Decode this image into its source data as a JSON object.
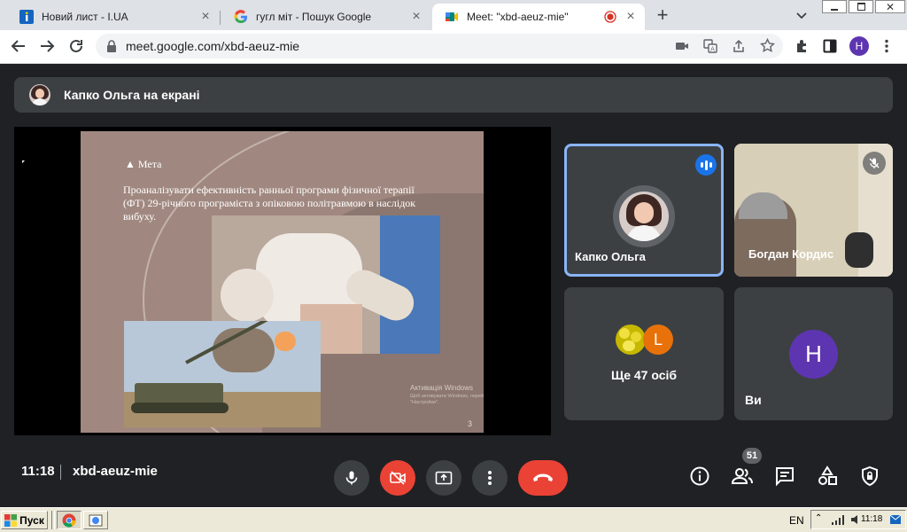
{
  "browser": {
    "tabs": [
      {
        "title": "Новий лист - I.UA",
        "close": "×"
      },
      {
        "title": "гугл міт - Пошук Google",
        "close": "×"
      },
      {
        "title": "Meet: \"xbd-aeuz-mie\"",
        "close": "×"
      }
    ],
    "new_tab": "+",
    "url": "meet.google.com/xbd-aeuz-mie",
    "profile_initial": "H"
  },
  "meet": {
    "presenter_banner": "Капко Ольга на екрані",
    "slide": {
      "heading": "▲ Мета",
      "body": "Проаналізувати ефективність ранньої програми фізичної терапії (ФТ) 29-річного програміста з опіковою політравмою в наслідок вибуху.",
      "watermark_title": "Активація Windows",
      "watermark_text": "Щоб активувати Windows, перейдіть до розділу \"Настройки\".",
      "page_number": "3"
    },
    "tiles": [
      {
        "name": "Капко Ольга",
        "speaking": true
      },
      {
        "name": "Богдан Кордис",
        "muted": true
      },
      {
        "name": "Ще 47 осіб",
        "avatar_letter": "L"
      },
      {
        "name": "Ви",
        "avatar_letter": "H"
      }
    ],
    "bottom": {
      "time": "11:18",
      "meeting_code": "xbd-aeuz-mie",
      "people_count": "51"
    },
    "colors": {
      "accent_blue": "#8ab4f8",
      "speaking_blue": "#1a73e8",
      "end_red": "#ea4335",
      "you_avatar": "#5e35b1",
      "l_avatar": "#e8710a"
    }
  },
  "taskbar": {
    "start_label": "Пуск",
    "lang": "EN",
    "clock": "11:18"
  }
}
